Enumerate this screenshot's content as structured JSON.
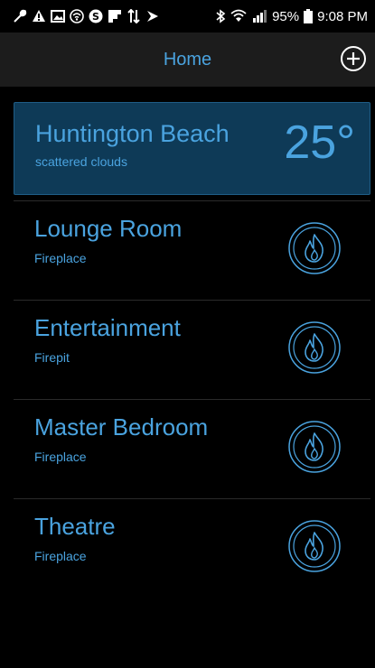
{
  "status_bar": {
    "battery": "95%",
    "time": "9:08 PM",
    "left_icons": [
      "wrench-icon",
      "warning-icon",
      "image-icon",
      "wifi-icon",
      "s-icon",
      "flipboard-icon",
      "transfer-icon",
      "media-icon"
    ],
    "right_icons": [
      "bluetooth-icon",
      "wifi-icon",
      "signal-icon",
      "battery-icon"
    ]
  },
  "app_bar": {
    "title": "Home",
    "add_icon": "plus-circle-icon"
  },
  "weather": {
    "city": "Huntington Beach",
    "description": "scattered clouds",
    "temperature": "25°"
  },
  "rooms": [
    {
      "name": "Lounge Room",
      "type": "Fireplace",
      "icon": "flame-icon"
    },
    {
      "name": "Entertainment",
      "type": "Firepit",
      "icon": "flame-icon"
    },
    {
      "name": "Master Bedroom",
      "type": "Fireplace",
      "icon": "flame-icon"
    },
    {
      "name": "Theatre",
      "type": "Fireplace",
      "icon": "flame-icon"
    }
  ],
  "colors": {
    "accent": "#4aa3df",
    "background": "#000000",
    "app_bar": "#1c1c1c",
    "weather_card": "#0e3a57"
  }
}
